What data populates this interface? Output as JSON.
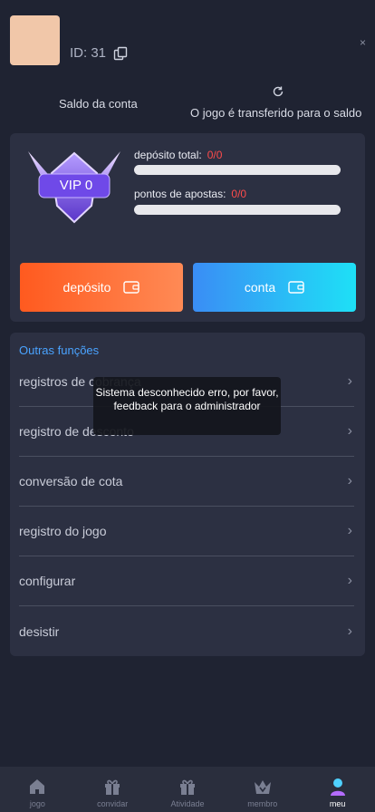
{
  "header": {
    "user_id": "ID: 31",
    "close": "×",
    "saldo_label": "Saldo da conta",
    "transfer_note": "O jogo é transferido para o saldo"
  },
  "vip": {
    "badge_label": "VIP 0",
    "deposit_label": "depósito total:",
    "deposit_value": "0/0",
    "bets_label": "pontos de apostas:",
    "bets_value": "0/0",
    "deposit_progress": 0,
    "bets_progress": 0
  },
  "actions": {
    "deposit_label": "depósito",
    "conta_label": "conta"
  },
  "menu": {
    "title": "Outras funções",
    "items": [
      {
        "label": "registros de cobrança"
      },
      {
        "label": "registro de desconto"
      },
      {
        "label": "conversão de cota"
      },
      {
        "label": "registro do jogo"
      },
      {
        "label": "configurar"
      },
      {
        "label": "desistir"
      }
    ]
  },
  "toast": {
    "message": "Sistema desconhecido erro, por favor, feedback para o administrador"
  },
  "tabs": [
    {
      "label": "jogo",
      "icon": "home-icon"
    },
    {
      "label": "convidar",
      "icon": "gift-icon"
    },
    {
      "label": "Atividade",
      "icon": "gift-icon"
    },
    {
      "label": "membro",
      "icon": "crown-icon"
    },
    {
      "label": "meu",
      "icon": "user-icon",
      "active": true
    }
  ],
  "colors": {
    "background": "#1f2332",
    "card": "#2c3042",
    "accent_blue": "#4aa3ff",
    "value_red": "#ff4b4b",
    "deposit_gradient": [
      "#ff5a1f",
      "#ff8a55"
    ],
    "conta_gradient": [
      "#3a8df5",
      "#1ee0f6"
    ]
  }
}
